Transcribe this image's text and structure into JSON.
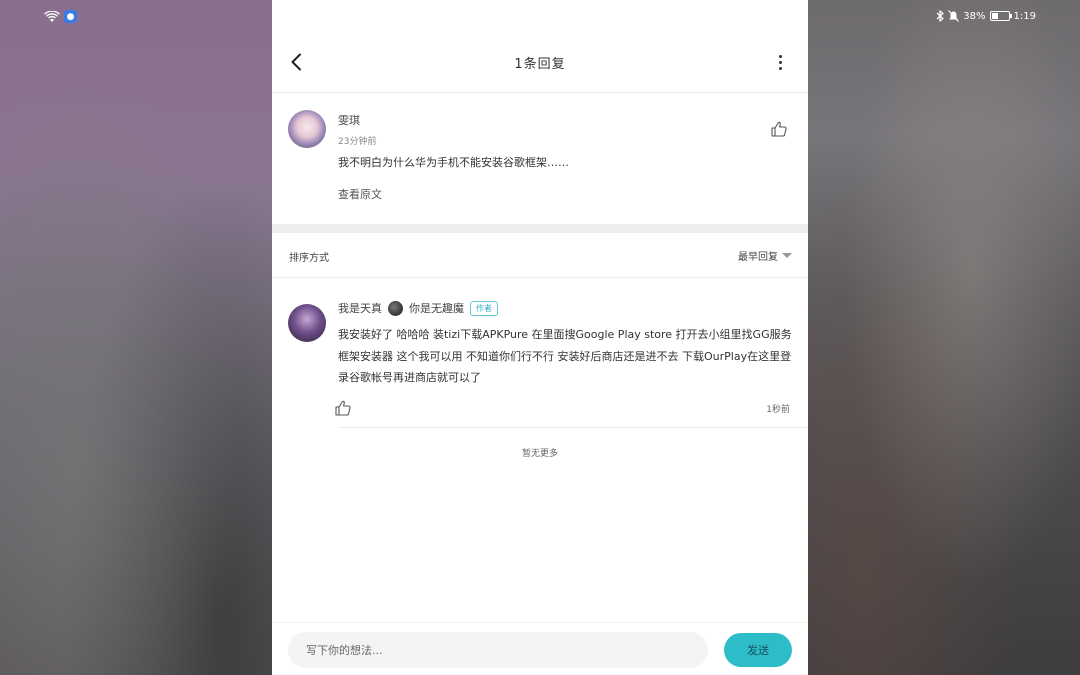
{
  "status_bar": {
    "battery_text": "38%",
    "battery_level": 0.38,
    "time": "1:19"
  },
  "header": {
    "title": "1条回复"
  },
  "main_comment": {
    "user_name": "雯琪",
    "time": "23分钟前",
    "text": "我不明白为什么华为手机不能安装谷歌框架……",
    "view_original": "查看原文"
  },
  "sort": {
    "label": "排序方式",
    "selected": "最早回复"
  },
  "reply": {
    "user_name_part1": "我是天真",
    "user_name_part2": "你是无趣魔",
    "badge": "作者",
    "text": "我安装好了 哈哈哈 装tizi下载APKPure 在里面搜Google Play store 打开去小组里找GG服务框架安装器 这个我可以用 不知道你们行不行 安装好后商店还是进不去 下载OurPlay在这里登录谷歌帐号再进商店就可以了",
    "time": "1秒前"
  },
  "no_more": "暂无更多",
  "input": {
    "placeholder": "写下你的想法..."
  },
  "send_label": "发送",
  "colors": {
    "accent": "#2cbdc8",
    "badge": "#2bb0c4"
  }
}
